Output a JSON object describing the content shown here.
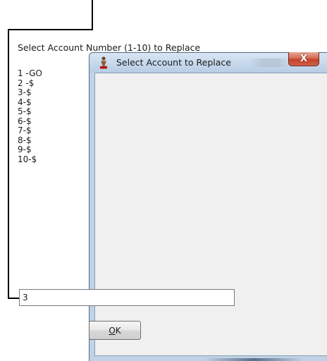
{
  "window": {
    "title": "Select Account to Replace",
    "close_label": "X"
  },
  "dialog": {
    "prompt": "Select Account Number (1-10) to Replace",
    "accounts": [
      "1 -GO",
      "2 -$",
      "3-$",
      "4-$",
      "5-$",
      "6-$",
      "7-$",
      "8-$",
      "9-$",
      "10-$"
    ],
    "input_value": "3",
    "ok_label": "OK"
  },
  "colors": {
    "annotation_line": "#000000",
    "close_button": "#c94a33"
  }
}
